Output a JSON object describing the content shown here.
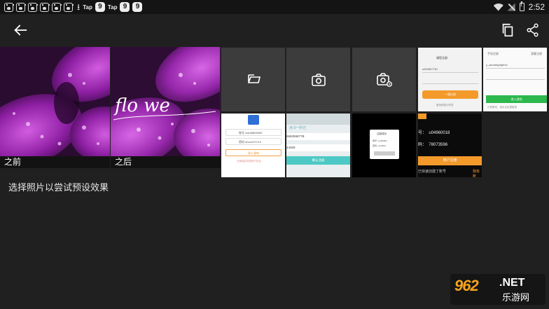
{
  "statusbar": {
    "left_texts": [
      "Tap",
      "Tap"
    ],
    "circle_glyph": "9",
    "time": "2:52"
  },
  "preview": {
    "before_label": "之前",
    "after_label": "之后",
    "watermark_script": "flo we"
  },
  "hint": "选择照片以尝试预设效果",
  "grid": {
    "actions": [
      "folder-icon",
      "camera-icon",
      "gear-camera-icon"
    ],
    "thumb_register": {
      "title": "请您注册",
      "field1": "u834567781",
      "field2": "",
      "button": "一键注册",
      "footer": "登录即表示同意"
    },
    "thumb_login": {
      "left_label": "手机注册",
      "right_label": "游客注册",
      "field": "y_abcdefghijklmn",
      "button": "进入游戏",
      "footer": "已有账号，请点击这里登录"
    },
    "thumb_account": {
      "row1_label": "账号",
      "row1_value": "nwr58805083",
      "row2_label": "密码",
      "row2_value": "4bcmXXYXX",
      "button": "进入游戏",
      "footer": "已阅读并同意用户协议"
    },
    "thumb_phone": {
      "top": "点 0一中己",
      "field1": "986359877B",
      "field2": "44009",
      "button": "确认注册"
    },
    "thumb_dialog": {
      "title": "注册成功",
      "line1": "账号: yu039654",
      "line2": "密码: ybc3812"
    },
    "thumb_account2": {
      "row1_label": "号：",
      "row1_value": "u04960018",
      "row2_label": "码：",
      "row2_value": "78073596",
      "button": "用户注册",
      "footer": "已快速创建了账号",
      "footer_right": "我有账"
    }
  },
  "watermark": {
    "logo": "962",
    "net": ".NET",
    "cn": "乐游网"
  }
}
